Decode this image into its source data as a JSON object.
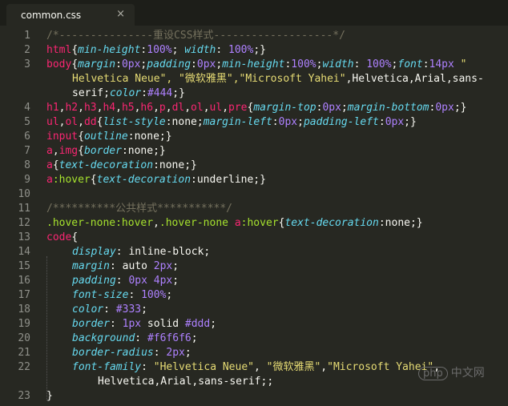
{
  "tab": {
    "title": "common.css",
    "close_glyph": "×"
  },
  "watermark": {
    "logo": "php",
    "site": "中文网"
  },
  "lines": [
    {
      "num": "1",
      "indent": 0,
      "tokens": [
        {
          "c": "c",
          "t": "/*---------------重设CSS样式-------------------*/"
        }
      ]
    },
    {
      "num": "2",
      "indent": 0,
      "tokens": [
        {
          "c": "t",
          "t": "html"
        },
        {
          "c": "x",
          "t": "{"
        },
        {
          "c": "p",
          "t": "min-height"
        },
        {
          "c": "x",
          "t": ":"
        },
        {
          "c": "n",
          "t": "100%"
        },
        {
          "c": "x",
          "t": "; "
        },
        {
          "c": "p",
          "t": "width"
        },
        {
          "c": "x",
          "t": ": "
        },
        {
          "c": "n",
          "t": "100%"
        },
        {
          "c": "x",
          "t": ";}"
        }
      ]
    },
    {
      "num": "3",
      "indent": 0,
      "tokens": [
        {
          "c": "t",
          "t": "body"
        },
        {
          "c": "x",
          "t": "{"
        },
        {
          "c": "p",
          "t": "margin"
        },
        {
          "c": "x",
          "t": ":"
        },
        {
          "c": "n",
          "t": "0px"
        },
        {
          "c": "x",
          "t": ";"
        },
        {
          "c": "p",
          "t": "padding"
        },
        {
          "c": "x",
          "t": ":"
        },
        {
          "c": "n",
          "t": "0px"
        },
        {
          "c": "x",
          "t": ";"
        },
        {
          "c": "p",
          "t": "min-height"
        },
        {
          "c": "x",
          "t": ":"
        },
        {
          "c": "n",
          "t": "100%"
        },
        {
          "c": "x",
          "t": ";"
        },
        {
          "c": "p",
          "t": "width"
        },
        {
          "c": "x",
          "t": ": "
        },
        {
          "c": "n",
          "t": "100%"
        },
        {
          "c": "x",
          "t": ";"
        },
        {
          "c": "p",
          "t": "font"
        },
        {
          "c": "x",
          "t": ":"
        },
        {
          "c": "n",
          "t": "14px"
        },
        {
          "c": "s",
          "t": " \""
        }
      ]
    },
    {
      "num": "",
      "indent": 1,
      "tokens": [
        {
          "c": "s",
          "t": "Helvetica Neue\", \"微软雅黑\",\"Microsoft Yahei\""
        },
        {
          "c": "x",
          "t": ",Helvetica,Arial,sans-"
        }
      ]
    },
    {
      "num": "",
      "indent": 1,
      "tokens": [
        {
          "c": "x",
          "t": "serif;"
        },
        {
          "c": "p",
          "t": "color"
        },
        {
          "c": "x",
          "t": ":"
        },
        {
          "c": "n",
          "t": "#444"
        },
        {
          "c": "x",
          "t": ";}"
        }
      ]
    },
    {
      "num": "4",
      "indent": 0,
      "tokens": [
        {
          "c": "t",
          "t": "h1"
        },
        {
          "c": "x",
          "t": ","
        },
        {
          "c": "t",
          "t": "h2"
        },
        {
          "c": "x",
          "t": ","
        },
        {
          "c": "t",
          "t": "h3"
        },
        {
          "c": "x",
          "t": ","
        },
        {
          "c": "t",
          "t": "h4"
        },
        {
          "c": "x",
          "t": ","
        },
        {
          "c": "t",
          "t": "h5"
        },
        {
          "c": "x",
          "t": ","
        },
        {
          "c": "t",
          "t": "h6"
        },
        {
          "c": "x",
          "t": ","
        },
        {
          "c": "t",
          "t": "p"
        },
        {
          "c": "x",
          "t": ","
        },
        {
          "c": "t",
          "t": "dl"
        },
        {
          "c": "x",
          "t": ","
        },
        {
          "c": "t",
          "t": "ol"
        },
        {
          "c": "x",
          "t": ","
        },
        {
          "c": "t",
          "t": "ul"
        },
        {
          "c": "x",
          "t": ","
        },
        {
          "c": "t",
          "t": "pre"
        },
        {
          "c": "x",
          "t": "{"
        },
        {
          "c": "p",
          "t": "margin-top"
        },
        {
          "c": "x",
          "t": ":"
        },
        {
          "c": "n",
          "t": "0px"
        },
        {
          "c": "x",
          "t": ";"
        },
        {
          "c": "p",
          "t": "margin-bottom"
        },
        {
          "c": "x",
          "t": ":"
        },
        {
          "c": "n",
          "t": "0px"
        },
        {
          "c": "x",
          "t": ";}"
        }
      ]
    },
    {
      "num": "5",
      "indent": 0,
      "tokens": [
        {
          "c": "t",
          "t": "ul"
        },
        {
          "c": "x",
          "t": ","
        },
        {
          "c": "t",
          "t": "ol"
        },
        {
          "c": "x",
          "t": ","
        },
        {
          "c": "t",
          "t": "dd"
        },
        {
          "c": "x",
          "t": "{"
        },
        {
          "c": "p",
          "t": "list-style"
        },
        {
          "c": "x",
          "t": ":none;"
        },
        {
          "c": "p",
          "t": "margin-left"
        },
        {
          "c": "x",
          "t": ":"
        },
        {
          "c": "n",
          "t": "0px"
        },
        {
          "c": "x",
          "t": ";"
        },
        {
          "c": "p",
          "t": "padding-left"
        },
        {
          "c": "x",
          "t": ":"
        },
        {
          "c": "n",
          "t": "0px"
        },
        {
          "c": "x",
          "t": ";}"
        }
      ]
    },
    {
      "num": "6",
      "indent": 0,
      "tokens": [
        {
          "c": "t",
          "t": "input"
        },
        {
          "c": "x",
          "t": "{"
        },
        {
          "c": "p",
          "t": "outline"
        },
        {
          "c": "x",
          "t": ":none;}"
        }
      ]
    },
    {
      "num": "7",
      "indent": 0,
      "tokens": [
        {
          "c": "t",
          "t": "a"
        },
        {
          "c": "x",
          "t": ","
        },
        {
          "c": "t",
          "t": "img"
        },
        {
          "c": "x",
          "t": "{"
        },
        {
          "c": "p",
          "t": "border"
        },
        {
          "c": "x",
          "t": ":none;}"
        }
      ]
    },
    {
      "num": "8",
      "indent": 0,
      "tokens": [
        {
          "c": "t",
          "t": "a"
        },
        {
          "c": "x",
          "t": "{"
        },
        {
          "c": "p",
          "t": "text-decoration"
        },
        {
          "c": "x",
          "t": ":none;}"
        }
      ]
    },
    {
      "num": "9",
      "indent": 0,
      "tokens": [
        {
          "c": "t",
          "t": "a"
        },
        {
          "c": "a",
          "t": ":hover"
        },
        {
          "c": "x",
          "t": "{"
        },
        {
          "c": "p",
          "t": "text-decoration"
        },
        {
          "c": "x",
          "t": ":underline;}"
        }
      ]
    },
    {
      "num": "10",
      "indent": 0,
      "tokens": []
    },
    {
      "num": "11",
      "indent": 0,
      "tokens": [
        {
          "c": "c",
          "t": "/**********公共样式***********/"
        }
      ]
    },
    {
      "num": "12",
      "indent": 0,
      "tokens": [
        {
          "c": "a",
          "t": ".hover-none:hover"
        },
        {
          "c": "x",
          "t": ","
        },
        {
          "c": "a",
          "t": ".hover-none"
        },
        {
          "c": "x",
          "t": " "
        },
        {
          "c": "t",
          "t": "a"
        },
        {
          "c": "a",
          "t": ":hover"
        },
        {
          "c": "x",
          "t": "{"
        },
        {
          "c": "p",
          "t": "text-decoration"
        },
        {
          "c": "x",
          "t": ":none;}"
        }
      ]
    },
    {
      "num": "13",
      "indent": 0,
      "tokens": [
        {
          "c": "t",
          "t": "code"
        },
        {
          "c": "x",
          "t": "{"
        }
      ]
    },
    {
      "num": "14",
      "indent": 1,
      "tokens": [
        {
          "c": "p",
          "t": "display"
        },
        {
          "c": "x",
          "t": ": inline-block;"
        }
      ]
    },
    {
      "num": "15",
      "indent": 1,
      "tokens": [
        {
          "c": "p",
          "t": "margin"
        },
        {
          "c": "x",
          "t": ": auto "
        },
        {
          "c": "n",
          "t": "2px"
        },
        {
          "c": "x",
          "t": ";"
        }
      ]
    },
    {
      "num": "16",
      "indent": 1,
      "tokens": [
        {
          "c": "p",
          "t": "padding"
        },
        {
          "c": "x",
          "t": ": "
        },
        {
          "c": "n",
          "t": "0px"
        },
        {
          "c": "x",
          "t": " "
        },
        {
          "c": "n",
          "t": "4px"
        },
        {
          "c": "x",
          "t": ";"
        }
      ]
    },
    {
      "num": "17",
      "indent": 1,
      "tokens": [
        {
          "c": "p",
          "t": "font-size"
        },
        {
          "c": "x",
          "t": ": "
        },
        {
          "c": "n",
          "t": "100%"
        },
        {
          "c": "x",
          "t": ";"
        }
      ]
    },
    {
      "num": "18",
      "indent": 1,
      "tokens": [
        {
          "c": "p",
          "t": "color"
        },
        {
          "c": "x",
          "t": ": "
        },
        {
          "c": "n",
          "t": "#333"
        },
        {
          "c": "x",
          "t": ";"
        }
      ]
    },
    {
      "num": "19",
      "indent": 1,
      "tokens": [
        {
          "c": "p",
          "t": "border"
        },
        {
          "c": "x",
          "t": ": "
        },
        {
          "c": "n",
          "t": "1px"
        },
        {
          "c": "x",
          "t": " solid "
        },
        {
          "c": "n",
          "t": "#ddd"
        },
        {
          "c": "x",
          "t": ";"
        }
      ]
    },
    {
      "num": "20",
      "indent": 1,
      "tokens": [
        {
          "c": "p",
          "t": "background"
        },
        {
          "c": "x",
          "t": ": "
        },
        {
          "c": "n",
          "t": "#f6f6f6"
        },
        {
          "c": "x",
          "t": ";"
        }
      ]
    },
    {
      "num": "21",
      "indent": 1,
      "tokens": [
        {
          "c": "p",
          "t": "border-radius"
        },
        {
          "c": "x",
          "t": ": "
        },
        {
          "c": "n",
          "t": "2px"
        },
        {
          "c": "x",
          "t": ";"
        }
      ]
    },
    {
      "num": "22",
      "indent": 1,
      "tokens": [
        {
          "c": "p",
          "t": "font-family"
        },
        {
          "c": "x",
          "t": ": "
        },
        {
          "c": "s",
          "t": "\"Helvetica Neue\""
        },
        {
          "c": "x",
          "t": ", "
        },
        {
          "c": "s",
          "t": "\"微软雅黑\""
        },
        {
          "c": "x",
          "t": ","
        },
        {
          "c": "s",
          "t": "\"Microsoft Yahei\""
        },
        {
          "c": "x",
          "t": ","
        }
      ]
    },
    {
      "num": "",
      "indent": 2,
      "tokens": [
        {
          "c": "x",
          "t": "Helvetica,Arial,sans-serif;;"
        }
      ]
    },
    {
      "num": "23",
      "indent": 0,
      "tokens": [
        {
          "c": "x",
          "t": "}"
        }
      ]
    }
  ]
}
